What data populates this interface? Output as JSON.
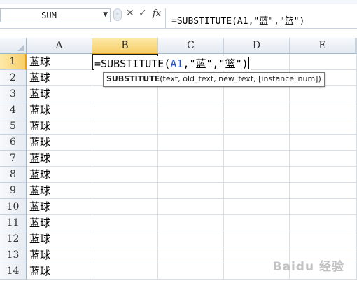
{
  "formula_bar": {
    "name_box": "SUM",
    "name_box_dropdown_icon": "chevron-down-icon",
    "cancel_icon": "✕",
    "enter_icon": "✓",
    "fx_label": "fx",
    "formula": "=SUBSTITUTE(A1,\"蓝\",\"篮\")"
  },
  "sheet": {
    "columns": [
      "A",
      "B",
      "C",
      "D",
      "E"
    ],
    "selected_column": "B",
    "selected_row": 1,
    "rows": [
      {
        "number": "1",
        "a": "蓝球"
      },
      {
        "number": "2",
        "a": "蓝球"
      },
      {
        "number": "3",
        "a": "蓝球"
      },
      {
        "number": "4",
        "a": "蓝球"
      },
      {
        "number": "5",
        "a": "蓝球"
      },
      {
        "number": "6",
        "a": "蓝球"
      },
      {
        "number": "7",
        "a": "蓝球"
      },
      {
        "number": "8",
        "a": "蓝球"
      },
      {
        "number": "9",
        "a": "蓝球"
      },
      {
        "number": "10",
        "a": "蓝球"
      },
      {
        "number": "11",
        "a": "蓝球"
      },
      {
        "number": "12",
        "a": "蓝球"
      },
      {
        "number": "13",
        "a": "蓝球"
      },
      {
        "number": "14",
        "a": "蓝球"
      }
    ]
  },
  "editing": {
    "prefix": "=SUBSTITUTE(",
    "ref": "A1",
    "suffix": ",\"蓝\",\"篮\")"
  },
  "tooltip": {
    "function_name": "SUBSTITUTE",
    "args": "(text, old_text, new_text, [instance_num])"
  },
  "watermark": "Baidu 经验",
  "colors": {
    "reference_blue": "#2a55c8",
    "selected_header": "#f7cf6a",
    "gridline": "#d9dee5"
  }
}
